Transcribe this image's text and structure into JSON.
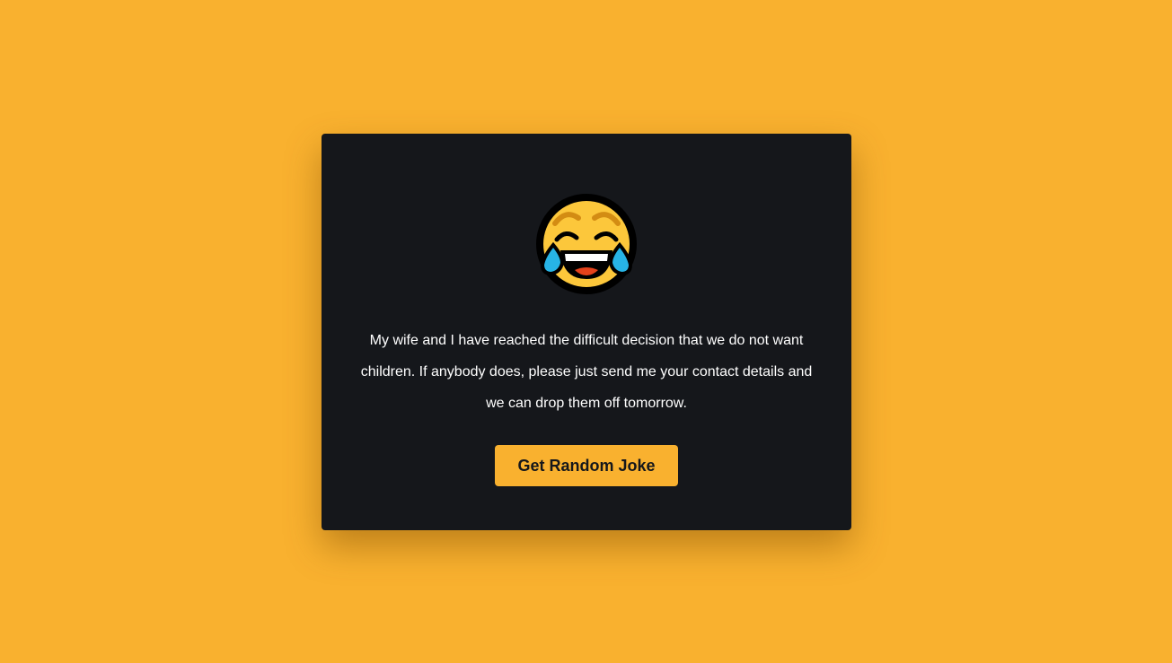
{
  "theme": {
    "background": "#f9b12f",
    "card": "#15171b",
    "accent": "#f9b12f",
    "text": "#ffffff"
  },
  "card": {
    "emoji_icon": "face-with-tears-of-joy-icon",
    "joke": "My wife and I have reached the difficult decision that we do not want children. If anybody does, please just send me your contact details and we can drop them off tomorrow.",
    "button_label": "Get Random Joke"
  }
}
